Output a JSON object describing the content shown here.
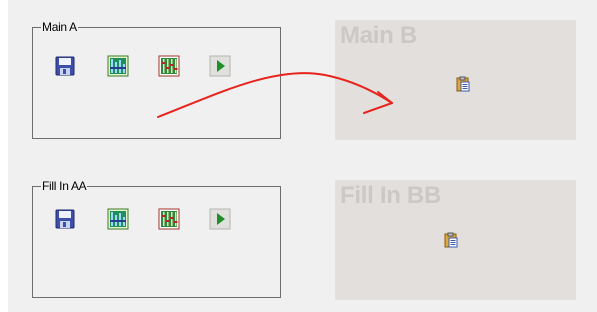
{
  "groups": {
    "main_a": {
      "title": "Main A"
    },
    "fill_in_aa": {
      "title": "Fill In AA"
    }
  },
  "panels": {
    "main_b": {
      "title": "Main B"
    },
    "fill_in_bb": {
      "title": "Fill In BB"
    }
  },
  "icons": {
    "save": "save-icon",
    "bar_chart": "bar-chart-icon",
    "equalizer": "equalizer-icon",
    "play": "play-icon",
    "paste": "paste-icon"
  },
  "colors": {
    "arrow": "#e8231d",
    "panel_bg": "#e2dfdc",
    "panel_title": "#cbc8c6",
    "canvas_bg": "#f0f0f0",
    "play_green": "#1f8f2a"
  }
}
